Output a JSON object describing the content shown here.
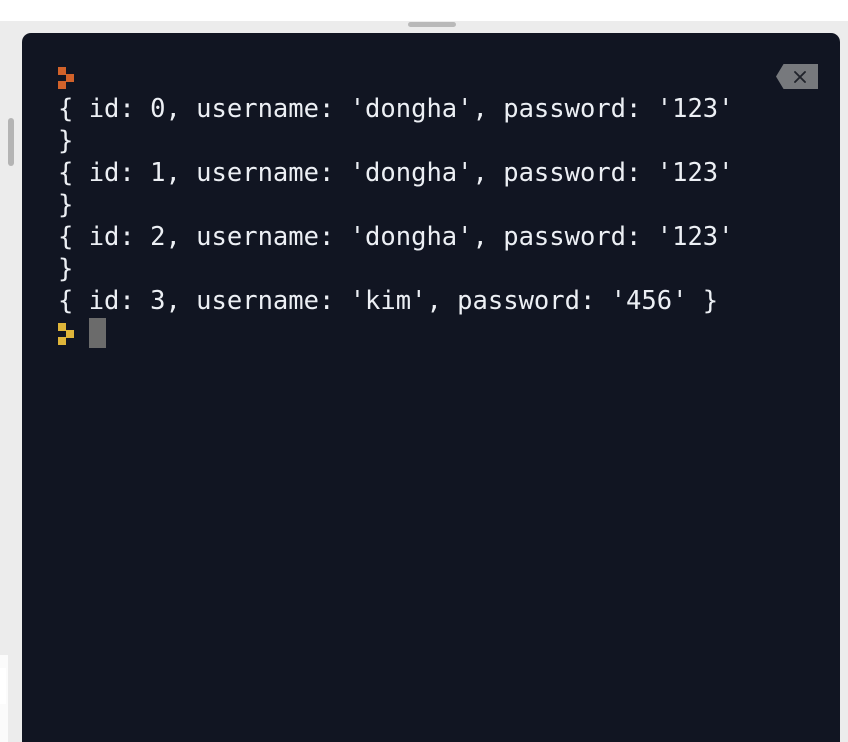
{
  "window": {
    "background_color": "#ececec",
    "editor_background": "#ffffff"
  },
  "panel": {
    "name": "terminal",
    "background_color": "#111522",
    "resize_handle": "panel-resize-handle",
    "close_button": {
      "icon": "close-x-icon",
      "label": "×",
      "color": "#77797d"
    }
  },
  "scrollbar": {
    "orientation": "vertical",
    "thumb_color": "#b4b4b4"
  },
  "terminal": {
    "foreground_color": "#eceff4",
    "prompt_glyph": "pixel-chevron-icon",
    "prompt_color_previous": "#d2622a",
    "prompt_color_current": "#dfb53a",
    "cursor_color": "#6b6b6b",
    "lines": [
      {
        "type": "prompt",
        "prompt_color": "orange",
        "text": ""
      },
      {
        "type": "output",
        "text": "{ id: 0, username: 'dongha', password: '123'"
      },
      {
        "type": "output",
        "text": "}"
      },
      {
        "type": "output",
        "text": "{ id: 1, username: 'dongha', password: '123'"
      },
      {
        "type": "output",
        "text": "}"
      },
      {
        "type": "output",
        "text": "{ id: 2, username: 'dongha', password: '123'"
      },
      {
        "type": "output",
        "text": "}"
      },
      {
        "type": "output",
        "text": "{ id: 3, username: 'kim', password: '456' }"
      },
      {
        "type": "prompt-active",
        "prompt_color": "yellow",
        "text": ""
      }
    ],
    "line_0_prompt": "",
    "line_1": "{ id: 0, username: 'dongha', password: '123'",
    "line_2": "}",
    "line_3": "{ id: 1, username: 'dongha', password: '123'",
    "line_4": "}",
    "line_5": "{ id: 2, username: 'dongha', password: '123'",
    "line_6": "}",
    "line_7": "{ id: 3, username: 'kim', password: '456' }",
    "line_8_prompt": ""
  }
}
